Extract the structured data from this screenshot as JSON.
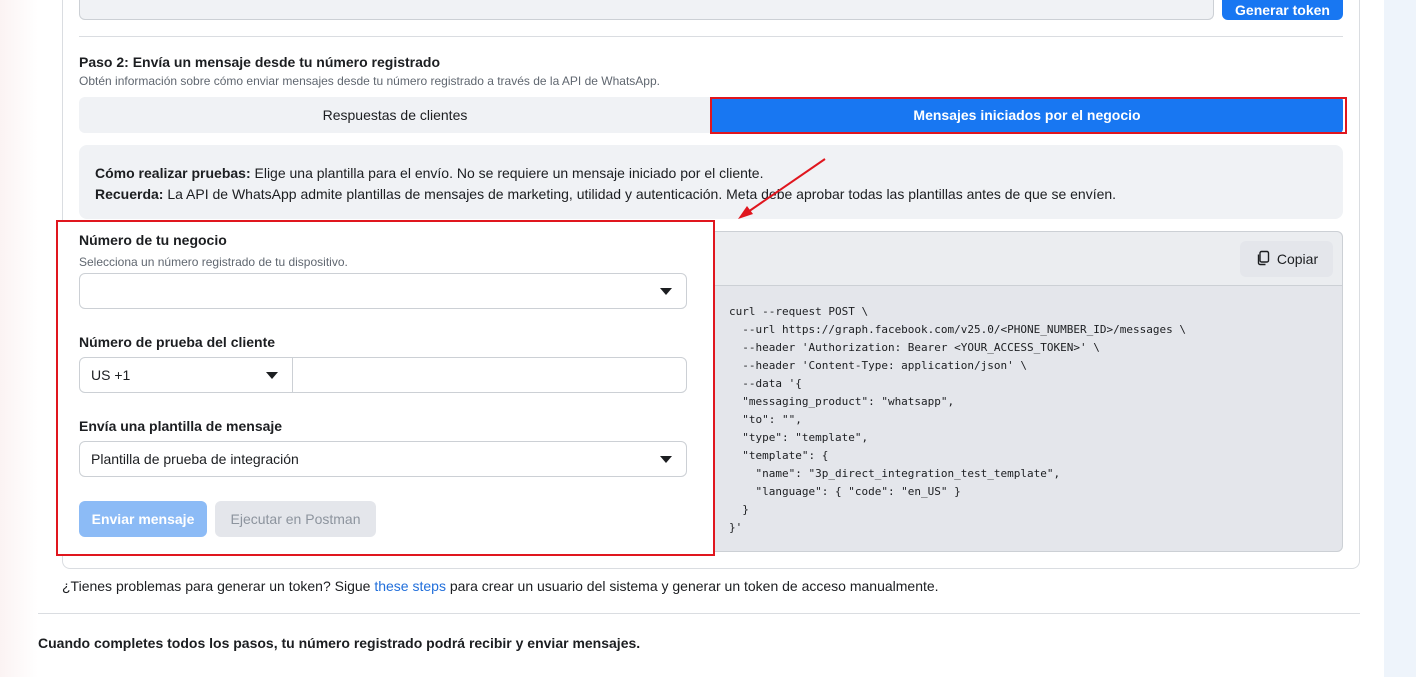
{
  "header": {
    "generate_token_label": "Generar token"
  },
  "step2": {
    "title": "Paso 2: Envía un mensaje desde tu número registrado",
    "subtitle": "Obtén información sobre cómo enviar mensajes desde tu número registrado a través de la API de WhatsApp.",
    "tabs": [
      {
        "label": "Respuestas de clientes",
        "active": false
      },
      {
        "label": "Mensajes iniciados por el negocio",
        "active": true
      }
    ],
    "info": {
      "line1_bold": "Cómo realizar pruebas:",
      "line1_text": " Elige una plantilla para el envío. No se requiere un mensaje iniciado por el cliente.",
      "line2_bold": "Recuerda:",
      "line2_text": " La API de WhatsApp admite plantillas de mensajes de marketing, utilidad y autenticación. Meta debe aprobar todas las plantillas antes de que se envíen."
    }
  },
  "form": {
    "business_number_label": "Número de tu negocio",
    "business_number_hint": "Selecciona un número registrado de tu dispositivo.",
    "business_number_value": "",
    "customer_number_label": "Número de prueba del cliente",
    "country_code_value": "US +1",
    "customer_number_value": "",
    "template_label": "Envía una plantilla de mensaje",
    "template_value": "Plantilla de prueba de integración",
    "send_button_label": "Enviar mensaje",
    "postman_button_label": "Ejecutar en Postman"
  },
  "code_panel": {
    "copy_label": "Copiar",
    "code": "curl --request POST \\\n  --url https://graph.facebook.com/v25.0/<PHONE_NUMBER_ID>/messages \\\n  --header 'Authorization: Bearer <YOUR_ACCESS_TOKEN>' \\\n  --header 'Content-Type: application/json' \\\n  --data '{\n  \"messaging_product\": \"whatsapp\",\n  \"to\": \"\",\n  \"type\": \"template\",\n  \"template\": {\n    \"name\": \"3p_direct_integration_test_template\",\n    \"language\": { \"code\": \"en_US\" }\n  }\n}'"
  },
  "footer": {
    "trouble_prefix": "¿Tienes problemas para generar un token? Sigue ",
    "trouble_link": "these steps",
    "trouble_suffix": " para crear un usuario del sistema y generar un token de acceso manualmente.",
    "final_note": "Cuando completes todos los pasos, tu número registrado podrá recibir y enviar mensajes."
  },
  "colors": {
    "accent": "#1877f2",
    "annotation_red": "#e0161e",
    "link": "#216fdb"
  },
  "icons": {
    "copy": "copy-icon",
    "dropdown": "caret-down-icon"
  }
}
